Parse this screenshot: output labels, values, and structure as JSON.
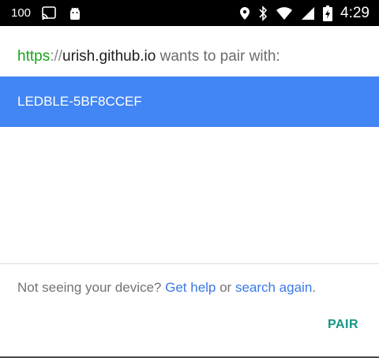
{
  "status_bar": {
    "battery_percent": "100",
    "clock": "4:29",
    "icons_left": [
      "cast-icon",
      "android-debug-icon"
    ],
    "icons_right": [
      "location-icon",
      "bluetooth-icon",
      "wifi-icon",
      "cell-signal-icon",
      "battery-charging-icon"
    ]
  },
  "dialog": {
    "title": {
      "scheme": "https",
      "separator": "://",
      "host": "urish.github.io",
      "suffix": " wants to pair with:"
    },
    "devices": [
      {
        "name": "LEDBLE-5BF8CCEF",
        "selected": true
      }
    ],
    "help": {
      "prefix": "Not seeing your device? ",
      "get_help": "Get help",
      "middle": " or ",
      "search_again": "search again",
      "suffix": "."
    },
    "pair_label": "PAIR"
  },
  "colors": {
    "selected_row": "#4285f4",
    "link": "#3b78e7",
    "https": "#1aa31a",
    "pair_button": "#159587"
  }
}
